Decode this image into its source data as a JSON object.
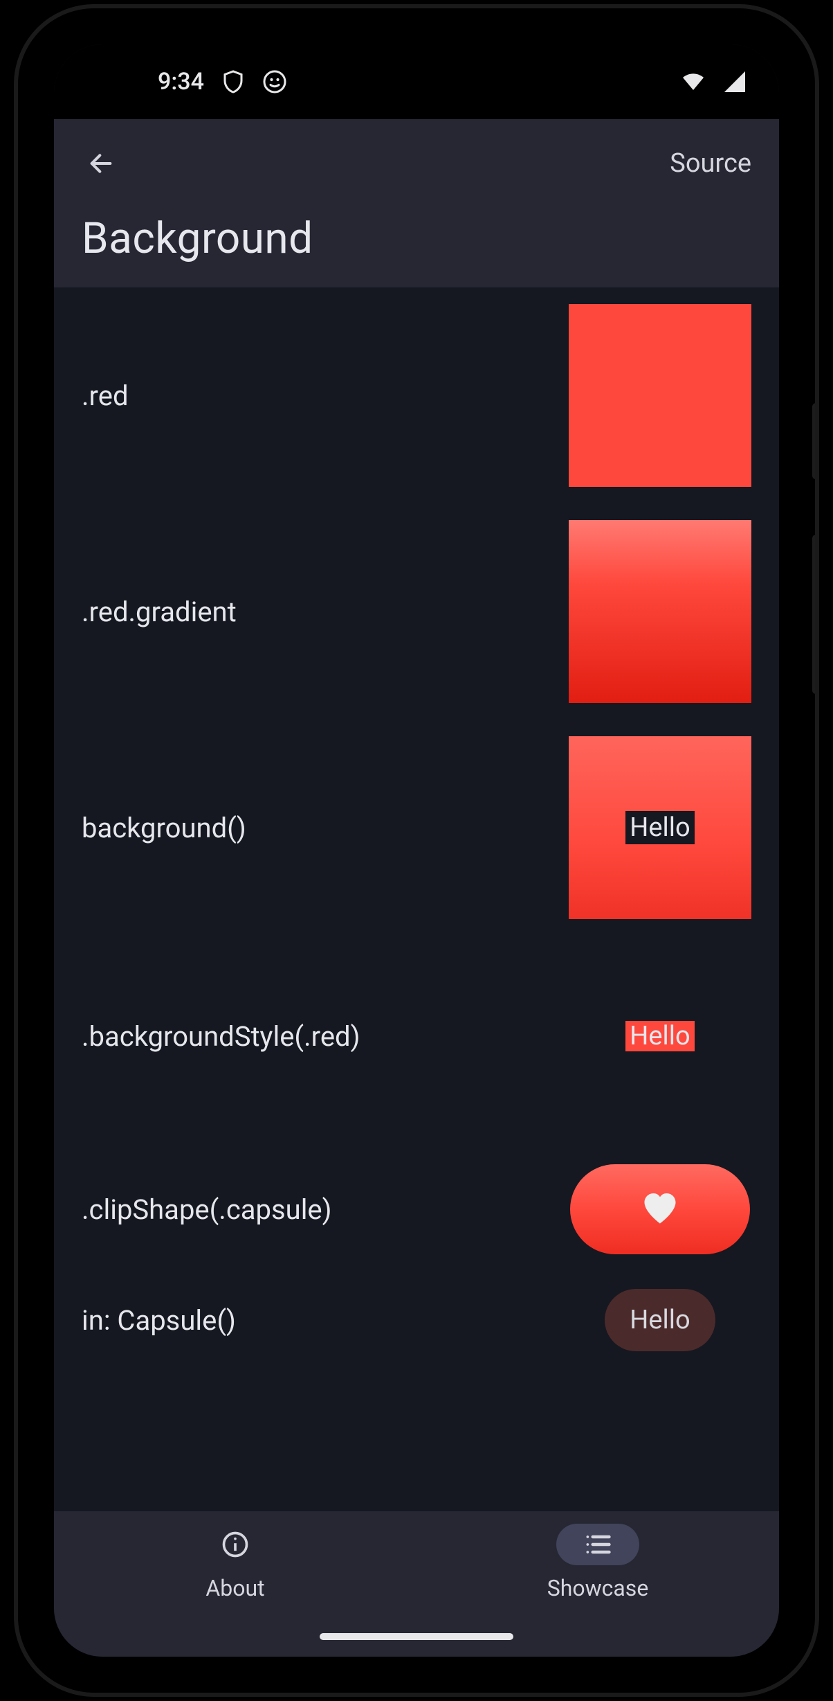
{
  "status": {
    "time": "9:34"
  },
  "appbar": {
    "title": "Background",
    "source": "Source"
  },
  "rows": {
    "red": {
      "label": ".red"
    },
    "gradient": {
      "label": ".red.gradient"
    },
    "background": {
      "label": "background()",
      "text": "Hello"
    },
    "style": {
      "label": ".backgroundStyle(.red)",
      "text": "Hello"
    },
    "clip": {
      "label": ".clipShape(.capsule)"
    },
    "incapsule": {
      "label": "in: Capsule()",
      "text": "Hello"
    }
  },
  "nav": {
    "about": {
      "label": "About"
    },
    "showcase": {
      "label": "Showcase"
    }
  },
  "colors": {
    "red": "#ff483d"
  }
}
